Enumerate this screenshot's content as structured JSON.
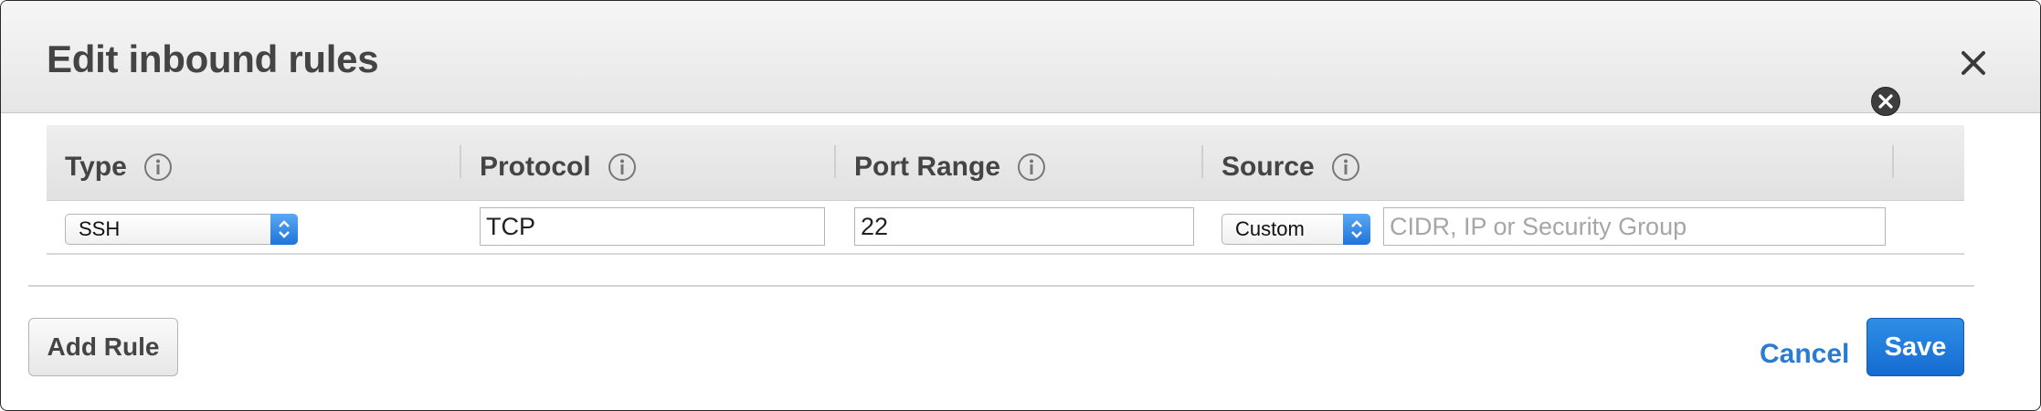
{
  "dialog": {
    "title": "Edit inbound rules",
    "close_icon": "close-icon"
  },
  "table": {
    "columns": [
      {
        "label": "Type",
        "icon": "info-icon"
      },
      {
        "label": "Protocol",
        "icon": "info-icon"
      },
      {
        "label": "Port Range",
        "icon": "info-icon"
      },
      {
        "label": "Source",
        "icon": "info-icon"
      }
    ],
    "rows": [
      {
        "type": "SSH",
        "protocol": "TCP",
        "port_range": "22",
        "source_select": "Custom",
        "source_placeholder": "CIDR, IP or Security Group",
        "remove_icon": "remove-circle-icon"
      }
    ]
  },
  "footer": {
    "add_rule_label": "Add Rule",
    "cancel_label": "Cancel",
    "save_label": "Save"
  },
  "colors": {
    "accent": "#2b7bd0",
    "save_button": "#1a72d8"
  }
}
